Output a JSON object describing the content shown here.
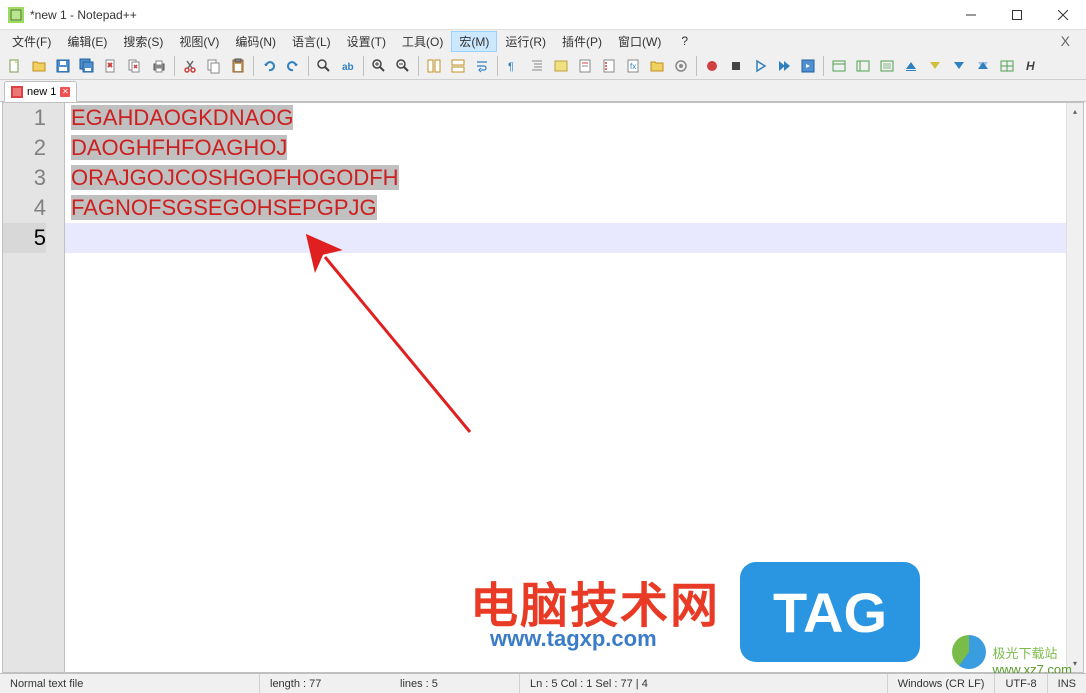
{
  "window": {
    "title": "*new 1 - Notepad++"
  },
  "menu": {
    "items": [
      "文件(F)",
      "编辑(E)",
      "搜索(S)",
      "视图(V)",
      "编码(N)",
      "语言(L)",
      "设置(T)",
      "工具(O)",
      "宏(M)",
      "运行(R)",
      "插件(P)",
      "窗口(W)"
    ],
    "help": "?",
    "x_right": "X",
    "active_index": 8
  },
  "tabs": {
    "items": [
      {
        "label": "new 1",
        "unsaved": true,
        "close": "✕"
      }
    ]
  },
  "editor": {
    "lines": [
      {
        "n": 1,
        "text": "EGAHDAOGKDNAOG",
        "selected": true
      },
      {
        "n": 2,
        "text": "DAOGHFHFOAGHOJ",
        "selected": true
      },
      {
        "n": 3,
        "text": "ORAJGOJCOSHGOFHOGODFH",
        "selected": true
      },
      {
        "n": 4,
        "text": "FAGNOFSGSEGOHSEPGPJG",
        "selected": true
      },
      {
        "n": 5,
        "text": "",
        "selected": false,
        "current": true
      }
    ]
  },
  "status": {
    "left": "Normal text file",
    "length": "length : 77",
    "lines": "lines : 5",
    "pos": "Ln : 5    Col : 1    Sel : 77 | 4",
    "eol": "Windows (CR LF)",
    "encoding": "UTF-8",
    "mode": "INS"
  },
  "watermark": {
    "text1": "电脑技术网",
    "sub": "www.tagxp.com",
    "tag": "TAG",
    "text2": "极光下载站",
    "url2": "www.xz7.com"
  }
}
